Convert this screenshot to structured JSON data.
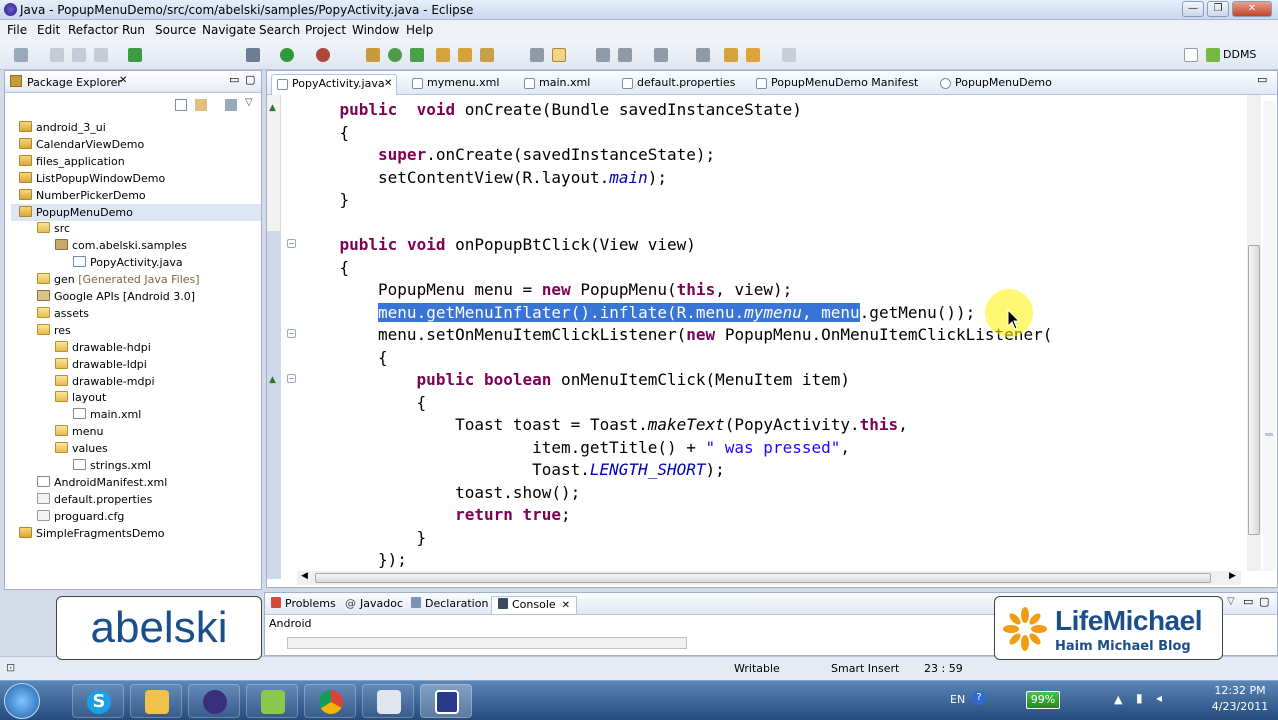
{
  "window": {
    "title": "Java - PopupMenuDemo/src/com/abelski/samples/PopyActivity.java - Eclipse"
  },
  "menubar": [
    "File",
    "Edit",
    "Refactor",
    "Run",
    "Source",
    "Navigate",
    "Search",
    "Project",
    "Window",
    "Help"
  ],
  "perspective": {
    "label": "DDMS"
  },
  "package_explorer": {
    "title": "Package Explorer",
    "items": [
      {
        "label": "android_3_ui",
        "indent": 1,
        "icon": "project-icon"
      },
      {
        "label": "CalendarViewDemo",
        "indent": 1,
        "icon": "project-icon"
      },
      {
        "label": "files_application",
        "indent": 1,
        "icon": "project-icon"
      },
      {
        "label": "ListPopupWindowDemo",
        "indent": 1,
        "icon": "project-icon"
      },
      {
        "label": "NumberPickerDemo",
        "indent": 1,
        "icon": "project-icon"
      },
      {
        "label": "PopupMenuDemo",
        "indent": 1,
        "icon": "project-icon",
        "selected": true
      },
      {
        "label": "src",
        "indent": 2,
        "icon": "folder-icon"
      },
      {
        "label": "com.abelski.samples",
        "indent": 3,
        "icon": "package-icon"
      },
      {
        "label": "PopyActivity.java",
        "indent": 4,
        "icon": "java-file-icon"
      },
      {
        "label": "gen",
        "suffix": "[Generated Java Files]",
        "indent": 2,
        "icon": "folder-icon"
      },
      {
        "label": "Google APIs [Android 3.0]",
        "indent": 2,
        "icon": "library-icon"
      },
      {
        "label": "assets",
        "indent": 2,
        "icon": "folder-icon"
      },
      {
        "label": "res",
        "indent": 2,
        "icon": "folder-icon"
      },
      {
        "label": "drawable-hdpi",
        "indent": 3,
        "icon": "folder-icon"
      },
      {
        "label": "drawable-ldpi",
        "indent": 3,
        "icon": "folder-icon"
      },
      {
        "label": "drawable-mdpi",
        "indent": 3,
        "icon": "folder-icon"
      },
      {
        "label": "layout",
        "indent": 3,
        "icon": "folder-icon"
      },
      {
        "label": "main.xml",
        "indent": 4,
        "icon": "xml-file-icon"
      },
      {
        "label": "menu",
        "indent": 3,
        "icon": "folder-icon"
      },
      {
        "label": "values",
        "indent": 3,
        "icon": "folder-icon"
      },
      {
        "label": "strings.xml",
        "indent": 4,
        "icon": "xml-file-icon"
      },
      {
        "label": "AndroidManifest.xml",
        "indent": 2,
        "icon": "xml-file-icon"
      },
      {
        "label": "default.properties",
        "indent": 2,
        "icon": "file-icon"
      },
      {
        "label": "proguard.cfg",
        "indent": 2,
        "icon": "file-icon"
      },
      {
        "label": "SimpleFragmentsDemo",
        "indent": 1,
        "icon": "project-icon"
      }
    ]
  },
  "editor_tabs": [
    {
      "label": "PopyActivity.java",
      "active": true,
      "close": "✕"
    },
    {
      "label": "mymenu.xml"
    },
    {
      "label": "main.xml"
    },
    {
      "label": "default.properties"
    },
    {
      "label": "PopupMenuDemo Manifest"
    },
    {
      "label": "PopupMenuDemo"
    }
  ],
  "code": [
    {
      "indent": 4,
      "parts": [
        [
          "kw",
          "public"
        ],
        [
          "",
          "  "
        ],
        [
          "kw",
          "void"
        ],
        [
          "",
          " onCreate(Bundle savedInstanceState)"
        ]
      ]
    },
    {
      "indent": 4,
      "parts": [
        [
          "",
          "{"
        ]
      ]
    },
    {
      "indent": 8,
      "parts": [
        [
          "kw",
          "super"
        ],
        [
          "",
          ".onCreate(savedInstanceState);"
        ]
      ]
    },
    {
      "indent": 8,
      "parts": [
        [
          "",
          "setContentView(R.layout."
        ],
        [
          "fld",
          "main"
        ],
        [
          "",
          ");"
        ]
      ]
    },
    {
      "indent": 4,
      "parts": [
        [
          "",
          "}"
        ]
      ]
    },
    {
      "indent": 0,
      "parts": []
    },
    {
      "indent": 4,
      "parts": [
        [
          "kw",
          "public"
        ],
        [
          "",
          " "
        ],
        [
          "kw",
          "void"
        ],
        [
          "",
          " onPopupBtClick(View view)"
        ]
      ]
    },
    {
      "indent": 4,
      "parts": [
        [
          "",
          "{"
        ]
      ]
    },
    {
      "indent": 8,
      "parts": [
        [
          "",
          "PopupMenu menu = "
        ],
        [
          "kw",
          "new"
        ],
        [
          "",
          " PopupMenu("
        ],
        [
          "kw",
          "this"
        ],
        [
          "",
          ", view);"
        ]
      ]
    },
    {
      "indent": 8,
      "parts": [
        [
          "sel",
          "menu.getMenuInflater().inflate(R.menu."
        ],
        [
          "sel fld",
          "mymenu"
        ],
        [
          "sel",
          ", menu"
        ],
        [
          "",
          ".getMenu());"
        ]
      ]
    },
    {
      "indent": 8,
      "parts": [
        [
          "",
          "menu.setOnMenuItemClickListener("
        ],
        [
          "kw",
          "new"
        ],
        [
          "",
          " PopupMenu.OnMenuItemClickListener("
        ]
      ]
    },
    {
      "indent": 8,
      "parts": [
        [
          "",
          "{"
        ]
      ]
    },
    {
      "indent": 12,
      "parts": [
        [
          "kw",
          "public"
        ],
        [
          "",
          " "
        ],
        [
          "kw",
          "boolean"
        ],
        [
          "",
          " onMenuItemClick(MenuItem item)"
        ]
      ]
    },
    {
      "indent": 12,
      "parts": [
        [
          "",
          "{"
        ]
      ]
    },
    {
      "indent": 16,
      "parts": [
        [
          "",
          "Toast toast = Toast."
        ],
        [
          "sti",
          "makeText"
        ],
        [
          "",
          "(PopyActivity."
        ],
        [
          "kw",
          "this"
        ],
        [
          "",
          ","
        ]
      ]
    },
    {
      "indent": 24,
      "parts": [
        [
          "",
          "item.getTitle() + "
        ],
        [
          "str",
          "\" was pressed\""
        ],
        [
          "",
          ","
        ]
      ]
    },
    {
      "indent": 24,
      "parts": [
        [
          "",
          "Toast."
        ],
        [
          "fld",
          "LENGTH_SHORT"
        ],
        [
          "",
          ");"
        ]
      ]
    },
    {
      "indent": 16,
      "parts": [
        [
          "",
          "toast.show();"
        ]
      ]
    },
    {
      "indent": 16,
      "parts": [
        [
          "kw",
          "return"
        ],
        [
          "",
          " "
        ],
        [
          "kw",
          "true"
        ],
        [
          "",
          ";"
        ]
      ]
    },
    {
      "indent": 12,
      "parts": [
        [
          "",
          "}"
        ]
      ]
    },
    {
      "indent": 8,
      "parts": [
        [
          "",
          "});"
        ]
      ]
    }
  ],
  "bottom_tabs": [
    {
      "label": "Problems"
    },
    {
      "label": "Javadoc"
    },
    {
      "label": "Declaration"
    },
    {
      "label": "Console",
      "active": true,
      "close": "✕"
    }
  ],
  "console": {
    "content": "Android"
  },
  "status": {
    "writable": "Writable",
    "insert_mode": "Smart Insert",
    "position": "23 : 59"
  },
  "taskbar": {
    "lang": "EN",
    "battery": "99%",
    "time": "12:32 PM",
    "date": "4/23/2011"
  },
  "watermarks": {
    "left": "abelski",
    "right_title": "LifeMichael",
    "right_subtitle": "Haim Michael Blog"
  },
  "colors": {
    "keyword": "#7f0055",
    "field": "#0000c0",
    "string": "#2a00ff",
    "selection": "#3875d7",
    "highlight": "#fff200"
  }
}
